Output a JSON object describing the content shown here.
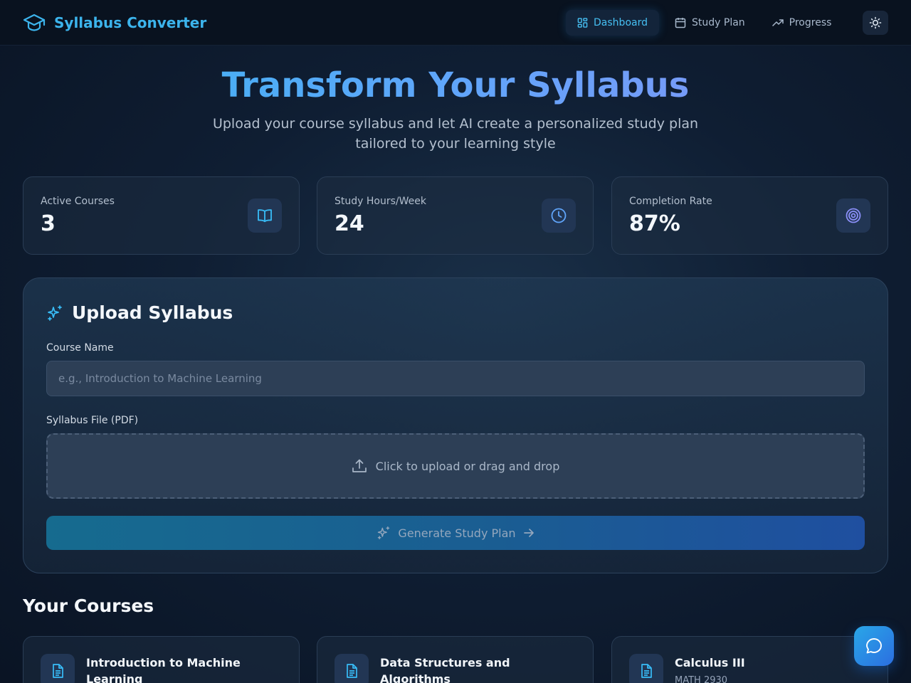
{
  "app": {
    "title": "Syllabus Converter",
    "logo_icon": "graduation-cap-icon",
    "accent": "#3cb4ec"
  },
  "nav": {
    "items": [
      {
        "label": "Dashboard",
        "icon": "layout-grid-icon",
        "active": true
      },
      {
        "label": "Study Plan",
        "icon": "calendar-icon",
        "active": false
      },
      {
        "label": "Progress",
        "icon": "trending-up-icon",
        "active": false
      }
    ],
    "theme_toggle_icon": "sun-icon"
  },
  "hero": {
    "title": "Transform Your Syllabus",
    "subtitle": "Upload your course syllabus and let AI create a personalized study plan tailored to your learning style"
  },
  "stats": [
    {
      "label": "Active Courses",
      "value": "3",
      "icon": "book-open-icon"
    },
    {
      "label": "Study Hours/Week",
      "value": "24",
      "icon": "clock-icon"
    },
    {
      "label": "Completion Rate",
      "value": "87%",
      "icon": "target-icon"
    }
  ],
  "upload": {
    "title": "Upload Syllabus",
    "title_icon": "sparkles-icon",
    "course_name_label": "Course Name",
    "course_name_placeholder": "e.g., Introduction to Machine Learning",
    "course_name_value": "",
    "file_label": "Syllabus File (PDF)",
    "dropzone_text": "Click to upload or drag and drop",
    "dropzone_icon": "upload-icon",
    "generate_label": "Generate Study Plan"
  },
  "courses": {
    "title": "Your Courses",
    "items": [
      {
        "name": "Introduction to Machine Learning",
        "code": "",
        "icon": "file-text-icon"
      },
      {
        "name": "Data Structures and Algorithms",
        "code": "",
        "icon": "file-text-icon"
      },
      {
        "name": "Calculus III",
        "code": "MATH 2930",
        "icon": "file-text-icon"
      }
    ]
  },
  "chat": {
    "icon": "message-circle-icon"
  }
}
